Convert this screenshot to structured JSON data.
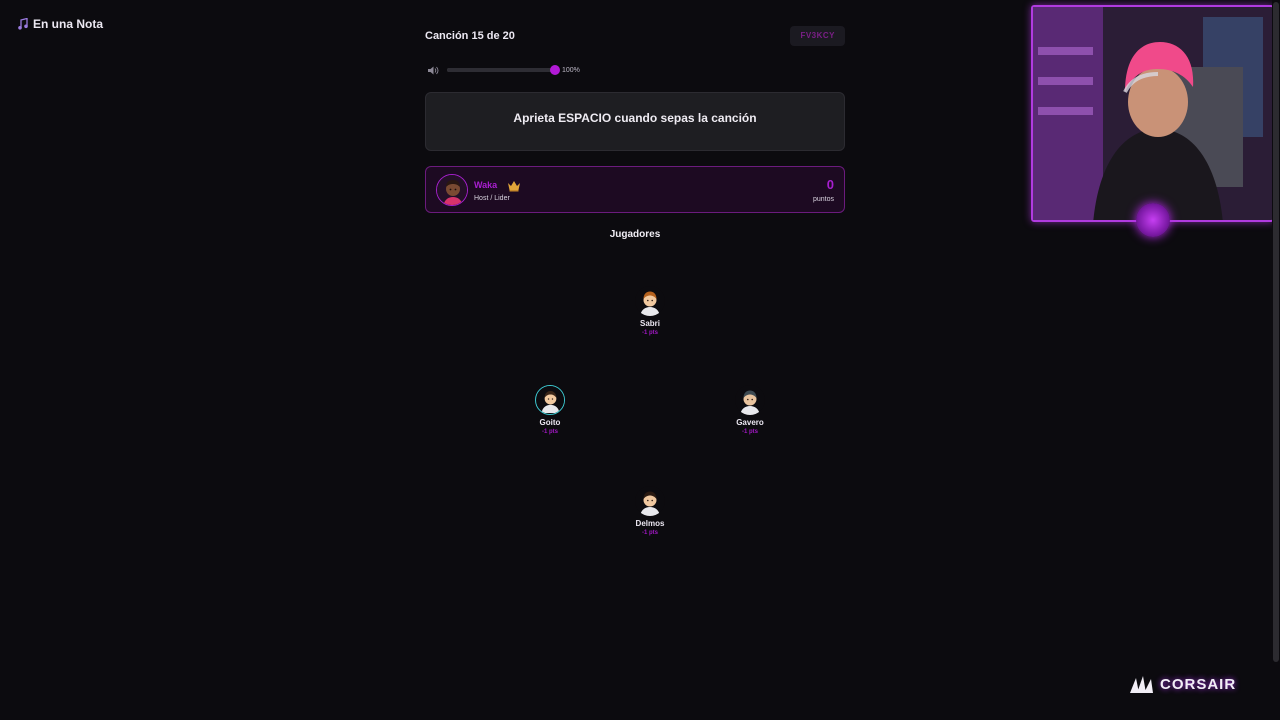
{
  "app": {
    "title": "En una Nota",
    "logo_icon": "music-note-icon"
  },
  "header": {
    "song_counter": "Canción 15 de 20",
    "room_code": "FV3KCY"
  },
  "volume": {
    "level_percent": 100,
    "label": "100%",
    "icon": "speaker-icon"
  },
  "prompt": {
    "text": "Aprieta ESPACIO cuando sepas la canción"
  },
  "host": {
    "name": "Waka",
    "role": "Host / Lider",
    "score": "0",
    "score_label": "puntos",
    "icon": "crown-icon",
    "accent": "#a81fd0"
  },
  "players_title": "Jugadores",
  "players": [
    {
      "name": "Sabri",
      "points": "-1 pts",
      "hair": "#b5621e",
      "skin": "#f1c9a0",
      "ring": false
    },
    {
      "name": "Goito",
      "points": "-1 pts",
      "hair": "#3a2518",
      "skin": "#f1c9a0",
      "ring": true
    },
    {
      "name": "Gavero",
      "points": "-1 pts",
      "hair": "#3d4a52",
      "skin": "#e8c39e",
      "ring": false
    },
    {
      "name": "Delmos",
      "points": "-1 pts",
      "hair": "#2a1a12",
      "skin": "#f0c8a0",
      "ring": false
    }
  ],
  "overlay": {
    "sponsor": "CORSAIR"
  },
  "colors": {
    "background": "#0c0b0f",
    "accent": "#b21ad6",
    "card": "#1e1e22"
  }
}
